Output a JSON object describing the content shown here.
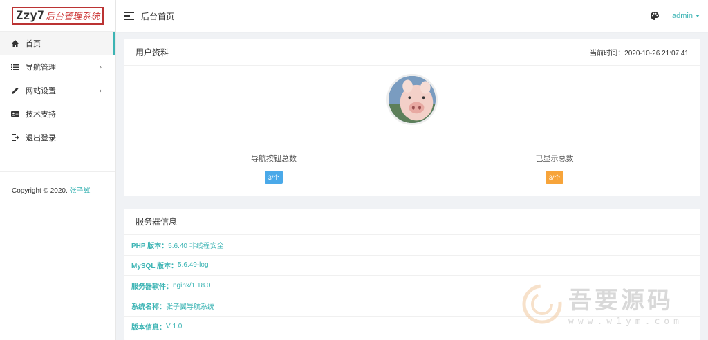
{
  "logo": {
    "main": "Zzy7",
    "sub": "后台管理系统"
  },
  "sidebar": {
    "items": [
      {
        "label": "首页",
        "icon": "home-icon"
      },
      {
        "label": "导航管理",
        "icon": "list-icon",
        "chevron": "›"
      },
      {
        "label": "网站设置",
        "icon": "pencil-icon",
        "chevron": "›"
      },
      {
        "label": "技术支持",
        "icon": "id-card-icon"
      },
      {
        "label": "退出登录",
        "icon": "logout-icon"
      }
    ],
    "copyright_prefix": "Copyright © 2020. ",
    "copyright_author": "张子翼"
  },
  "header": {
    "title": "后台首页",
    "user": "admin"
  },
  "profile": {
    "title": "用户资料",
    "time_label": "当前时间：2020-10-26 21:07:41",
    "stats": [
      {
        "label": "导航按钮总数",
        "value": "3/个",
        "color": "#4aa9e9"
      },
      {
        "label": "已显示总数",
        "value": "3/个",
        "color": "#f7a43a"
      }
    ]
  },
  "server": {
    "title": "服务器信息",
    "rows": [
      {
        "key": "PHP 版本：",
        "value": "5.6.40 非线程安全"
      },
      {
        "key": "MySQL 版本：",
        "value": "5.6.49-log"
      },
      {
        "key": "服务器软件：",
        "value": "nginx/1.18.0"
      },
      {
        "key": "系统名称：",
        "value": "张子翼导航系统"
      },
      {
        "key": "版本信息：",
        "value": "V 1.0"
      }
    ]
  },
  "watermark": {
    "big": "吾要源码",
    "small": "www.w1ym.com"
  },
  "colors": {
    "accent": "#3cb4b4",
    "blue_badge": "#4aa9e9",
    "orange_badge": "#f7a43a"
  }
}
